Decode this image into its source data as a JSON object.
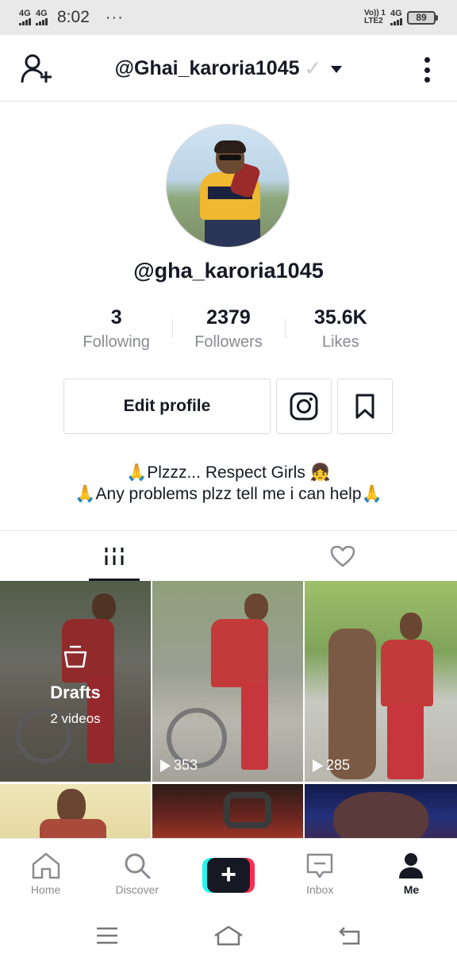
{
  "status_bar": {
    "signal1": "4G",
    "signal2": "4G",
    "time": "8:02",
    "dots": "···",
    "volte": "Vo)) 1",
    "lte": "LTE2",
    "net": "4G",
    "battery": "89"
  },
  "header": {
    "title": "@Ghai_karoria1045",
    "verify_mark": "✓"
  },
  "profile": {
    "handle": "@gha_karoria1045",
    "stats": [
      {
        "value": "3",
        "label": "Following"
      },
      {
        "value": "2379",
        "label": "Followers"
      },
      {
        "value": "35.6K",
        "label": "Likes"
      }
    ],
    "edit_label": "Edit profile",
    "bio_line1": "🙏Plzzz... Respect Girls 👧",
    "bio_line2": "🙏Any problems plzz tell me i can help🙏"
  },
  "videos": {
    "drafts_title": "Drafts",
    "drafts_count": "2 videos",
    "views": [
      "353",
      "285"
    ]
  },
  "bottom_nav": {
    "home": "Home",
    "discover": "Discover",
    "create": "+",
    "inbox": "Inbox",
    "me": "Me"
  },
  "colors": {
    "accent_cyan": "#25f4ee",
    "accent_red": "#fe2c55",
    "text": "#161823",
    "muted": "#8a8b91"
  }
}
